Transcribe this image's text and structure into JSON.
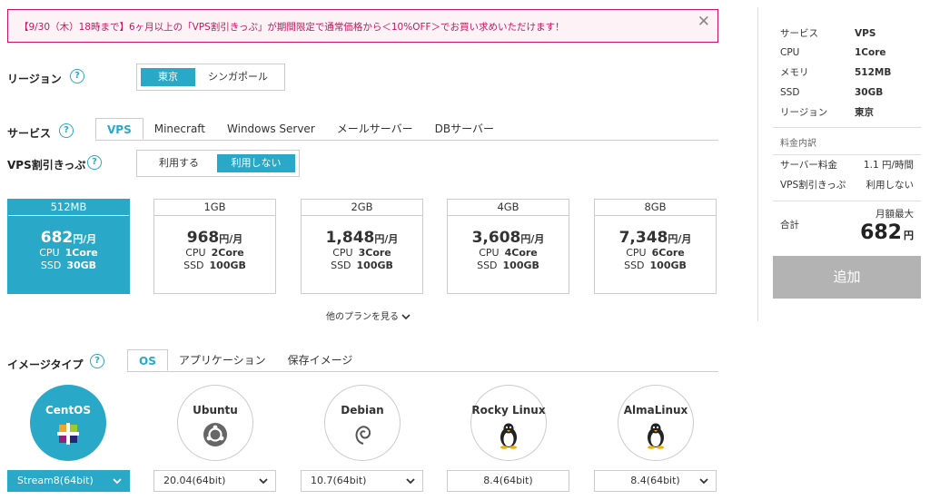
{
  "banner": {
    "text": "【9/30（木）18時まで】6ヶ月以上の「VPS割引きっぷ」が期間限定で通常価格から＜10%OFF＞でお買い求めいただけます！",
    "close": "✕"
  },
  "region": {
    "label": "リージョン",
    "options": [
      "東京",
      "シンガポール"
    ],
    "selected": "東京"
  },
  "service": {
    "label": "サービス",
    "tabs": [
      "VPS",
      "Minecraft",
      "Windows Server",
      "メールサーバー",
      "DBサーバー"
    ],
    "active_tab": "VPS"
  },
  "discount": {
    "label": "VPS割引きっぷ",
    "options": [
      "利用する",
      "利用しない"
    ],
    "selected": "利用しない"
  },
  "plans": [
    {
      "memory": "512MB",
      "price": "682",
      "unit": "円/月",
      "cpu_label": "CPU",
      "cpu": "1Core",
      "ssd_label": "SSD",
      "ssd": "30GB",
      "selected": true
    },
    {
      "memory": "1GB",
      "price": "968",
      "unit": "円/月",
      "cpu_label": "CPU",
      "cpu": "2Core",
      "ssd_label": "SSD",
      "ssd": "100GB",
      "selected": false
    },
    {
      "memory": "2GB",
      "price": "1,848",
      "unit": "円/月",
      "cpu_label": "CPU",
      "cpu": "3Core",
      "ssd_label": "SSD",
      "ssd": "100GB",
      "selected": false
    },
    {
      "memory": "4GB",
      "price": "3,608",
      "unit": "円/月",
      "cpu_label": "CPU",
      "cpu": "4Core",
      "ssd_label": "SSD",
      "ssd": "100GB",
      "selected": false
    },
    {
      "memory": "8GB",
      "price": "7,348",
      "unit": "円/月",
      "cpu_label": "CPU",
      "cpu": "6Core",
      "ssd_label": "SSD",
      "ssd": "100GB",
      "selected": false
    }
  ],
  "more_plans": "他のプランを見る",
  "image_type": {
    "label": "イメージタイプ",
    "tabs": [
      "OS",
      "アプリケーション",
      "保存イメージ"
    ],
    "active_tab": "OS"
  },
  "os_list": [
    {
      "name": "CentOS",
      "version": "Stream8(64bit)",
      "icon": "centos-logo-icon",
      "selected": true,
      "dropdown": true
    },
    {
      "name": "Ubuntu",
      "version": "20.04(64bit)",
      "icon": "ubuntu-logo-icon",
      "selected": false,
      "dropdown": true
    },
    {
      "name": "Debian",
      "version": "10.7(64bit)",
      "icon": "debian-swirl-icon",
      "selected": false,
      "dropdown": true
    },
    {
      "name": "Rocky Linux",
      "version": "8.4(64bit)",
      "icon": "tux-penguin-icon",
      "selected": false,
      "dropdown": false
    },
    {
      "name": "AlmaLinux",
      "version": "8.4(64bit)",
      "icon": "tux-penguin-icon",
      "selected": false,
      "dropdown": true
    }
  ],
  "summary": {
    "rows": [
      {
        "key": "サービス",
        "value": "VPS"
      },
      {
        "key": "CPU",
        "value": "1Core"
      },
      {
        "key": "メモリ",
        "value": "512MB"
      },
      {
        "key": "SSD",
        "value": "30GB"
      },
      {
        "key": "リージョン",
        "value": "東京"
      }
    ],
    "fee_title": "料金内訳",
    "fees": [
      {
        "key": "サーバー料金",
        "value": "1.1 円/時間"
      },
      {
        "key": "VPS割引きっぷ",
        "value": "利用しない"
      }
    ],
    "total_label": "合計",
    "total_note": "月額最大",
    "total_amount": "682",
    "total_unit": "円",
    "add_button": "追加"
  },
  "colors": {
    "accent": "#2aa8c8",
    "banner": "#c2185b",
    "disabled_button": "#b3b3b3"
  }
}
